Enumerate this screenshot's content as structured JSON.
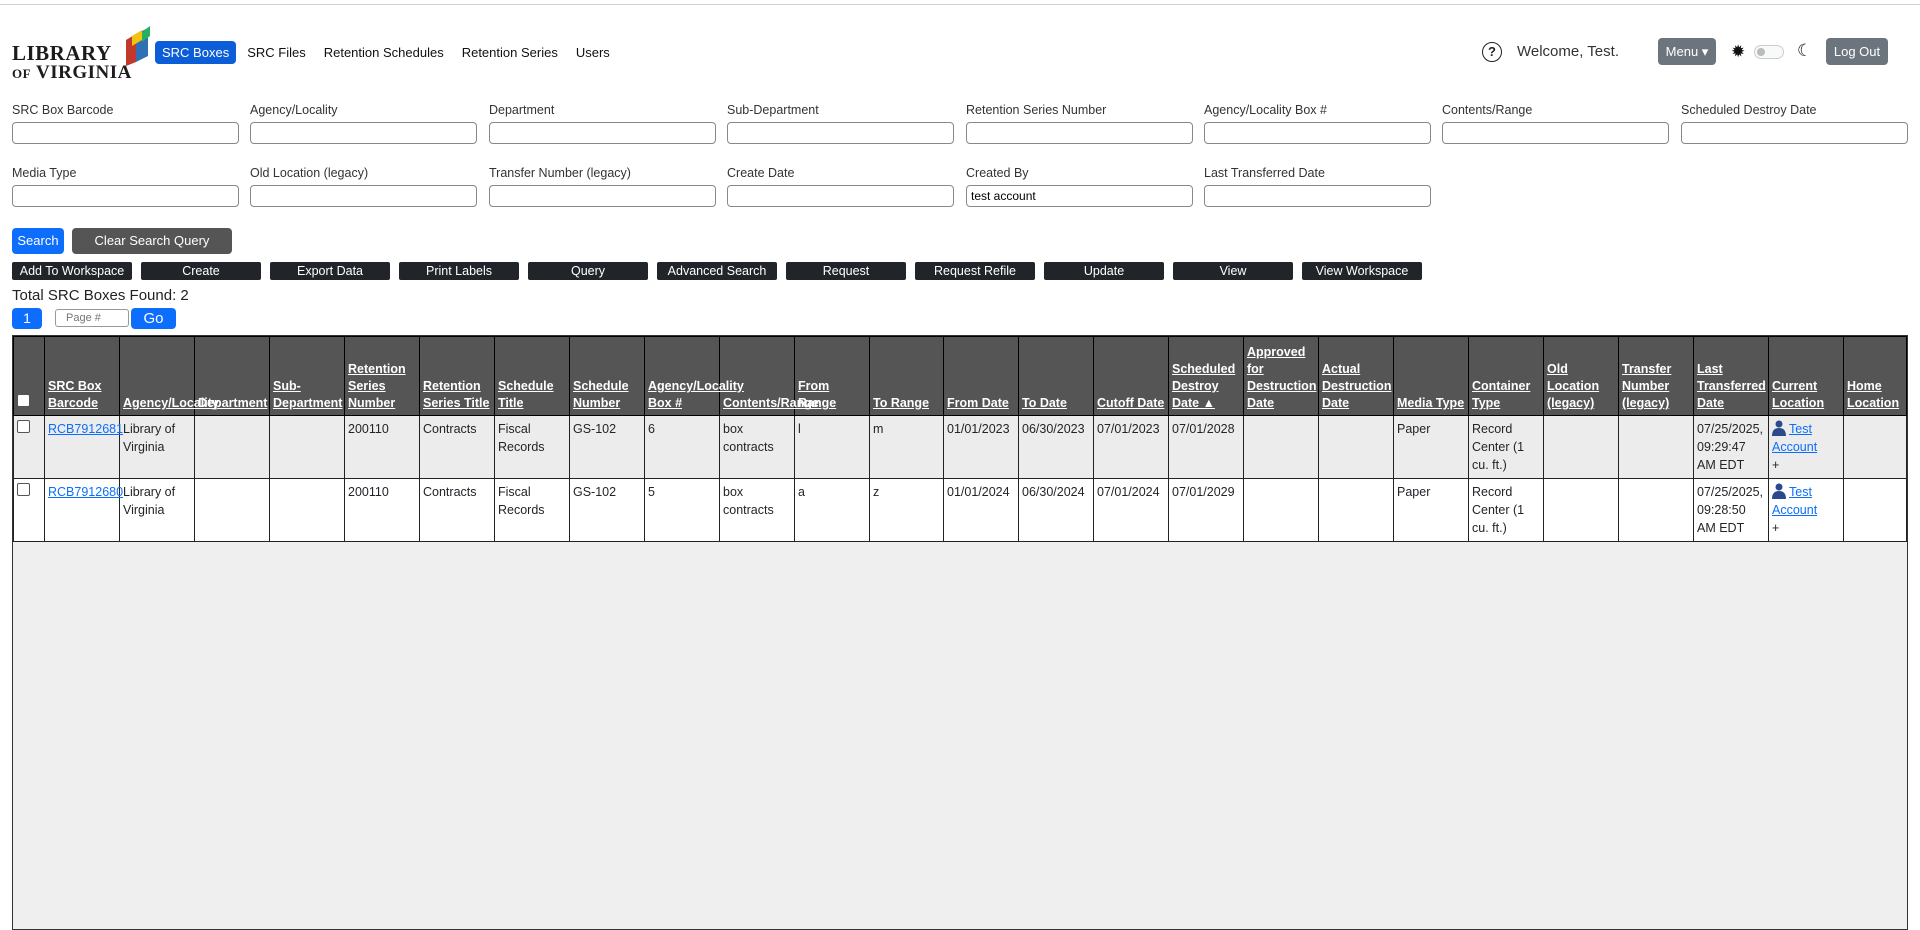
{
  "header": {
    "logo_line1": "LIBRARY",
    "logo_line2_prefix": "OF",
    "logo_line2": "VIRGINIA",
    "nav": [
      "SRC Boxes",
      "SRC Files",
      "Retention Schedules",
      "Retention Series",
      "Users"
    ],
    "active_nav": "SRC Boxes",
    "help_icon": "question-circle-icon",
    "welcome": "Welcome, Test.",
    "menu_label": "Menu ▾",
    "theme_icons": [
      "sun-gear-icon",
      "toggle-switch",
      "moon-icon"
    ],
    "logout_label": "Log Out"
  },
  "form": {
    "row1": [
      {
        "label": "SRC Box Barcode",
        "value": ""
      },
      {
        "label": "Agency/Locality",
        "value": ""
      },
      {
        "label": "Department",
        "value": ""
      },
      {
        "label": "Sub-Department",
        "value": ""
      },
      {
        "label": "Retention Series Number",
        "value": ""
      },
      {
        "label": "Agency/Locality Box #",
        "value": ""
      },
      {
        "label": "Contents/Range",
        "value": ""
      },
      {
        "label": "Scheduled Destroy Date",
        "value": ""
      }
    ],
    "row2": [
      {
        "label": "Media Type",
        "value": ""
      },
      {
        "label": "Old Location (legacy)",
        "value": ""
      },
      {
        "label": "Transfer Number (legacy)",
        "value": ""
      },
      {
        "label": "Create Date",
        "value": ""
      },
      {
        "label": "Created By",
        "value": "test account"
      },
      {
        "label": "Last Transferred Date",
        "value": ""
      }
    ],
    "search_label": "Search",
    "clear_label": "Clear Search Query"
  },
  "actions": [
    "Add To Workspace",
    "Create",
    "Export Data",
    "Print Labels",
    "Query",
    "Advanced Search",
    "Request",
    "Request Refile",
    "Update",
    "View",
    "View Workspace"
  ],
  "results": {
    "total_text": "Total SRC Boxes Found: 2",
    "current_page": "1",
    "page_placeholder": "Page #",
    "go_label": "Go"
  },
  "table": {
    "columns": [
      "SRC Box Barcode",
      "Agency/Locality",
      "Department",
      "Sub-Department",
      "Retention Series Number",
      "Retention Series Title",
      "Schedule Title",
      "Schedule Number",
      "Agency/Locality Box #",
      "Contents/Range",
      "From Range",
      "To Range",
      "From Date",
      "To Date",
      "Cutoff Date",
      "Scheduled Destroy Date ▲",
      "Approved for Destruction Date",
      "Actual Destruction Date",
      "Media Type",
      "Container Type",
      "Old Location (legacy)",
      "Transfer Number (legacy)",
      "Last Transferred Date",
      "Current Location",
      "Home Location"
    ],
    "rows": [
      [
        "RCB7912681",
        "Library of Virginia",
        "",
        "",
        "200110",
        "Contracts",
        "Fiscal Records",
        "GS-102",
        "6",
        "box contracts",
        "l",
        "m",
        "01/01/2023",
        "06/30/2023",
        "07/01/2023",
        "07/01/2028",
        "",
        "",
        "Paper",
        "Record Center (1 cu. ft.)",
        "",
        "",
        "07/25/2025, 09:29:47 AM EDT",
        "Test Account",
        ""
      ],
      [
        "RCB7912680",
        "Library of Virginia",
        "",
        "",
        "200110",
        "Contracts",
        "Fiscal Records",
        "GS-102",
        "5",
        "box contracts",
        "a",
        "z",
        "01/01/2024",
        "06/30/2024",
        "07/01/2024",
        "07/01/2029",
        "",
        "",
        "Paper",
        "Record Center (1 cu. ft.)",
        "",
        "",
        "07/25/2025, 09:28:50 AM EDT",
        "Test Account",
        ""
      ]
    ],
    "plus_label": "+"
  }
}
